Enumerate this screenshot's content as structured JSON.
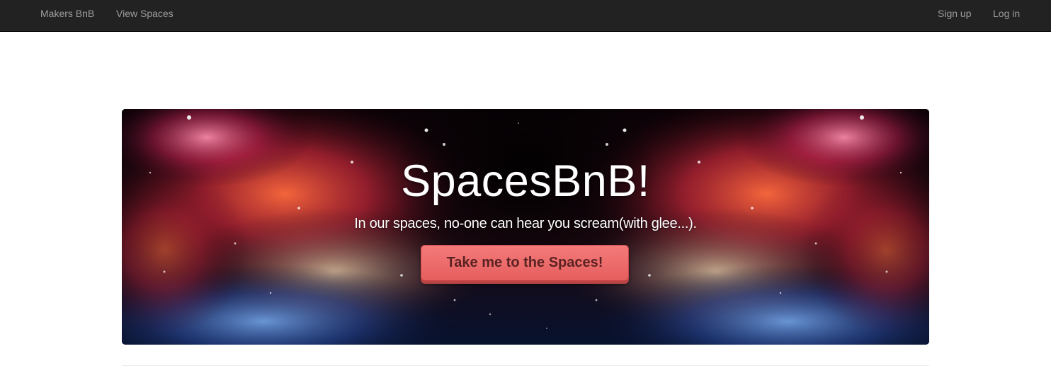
{
  "navbar": {
    "brand": "Makers BnB",
    "view_spaces": "View Spaces",
    "sign_up": "Sign up",
    "log_in": "Log in"
  },
  "hero": {
    "title": "SpacesBnB!",
    "subtitle": "In our spaces, no-one can hear you scream(with glee...).",
    "button_label": "Take me to the Spaces!",
    "background": "nebula-starfield-image"
  },
  "colors": {
    "navbar_bg": "#222222",
    "navbar_link": "#9d9d9d",
    "button_bg": "#f06a6a",
    "button_text": "#5a2222",
    "hero_text": "#ffffff"
  }
}
